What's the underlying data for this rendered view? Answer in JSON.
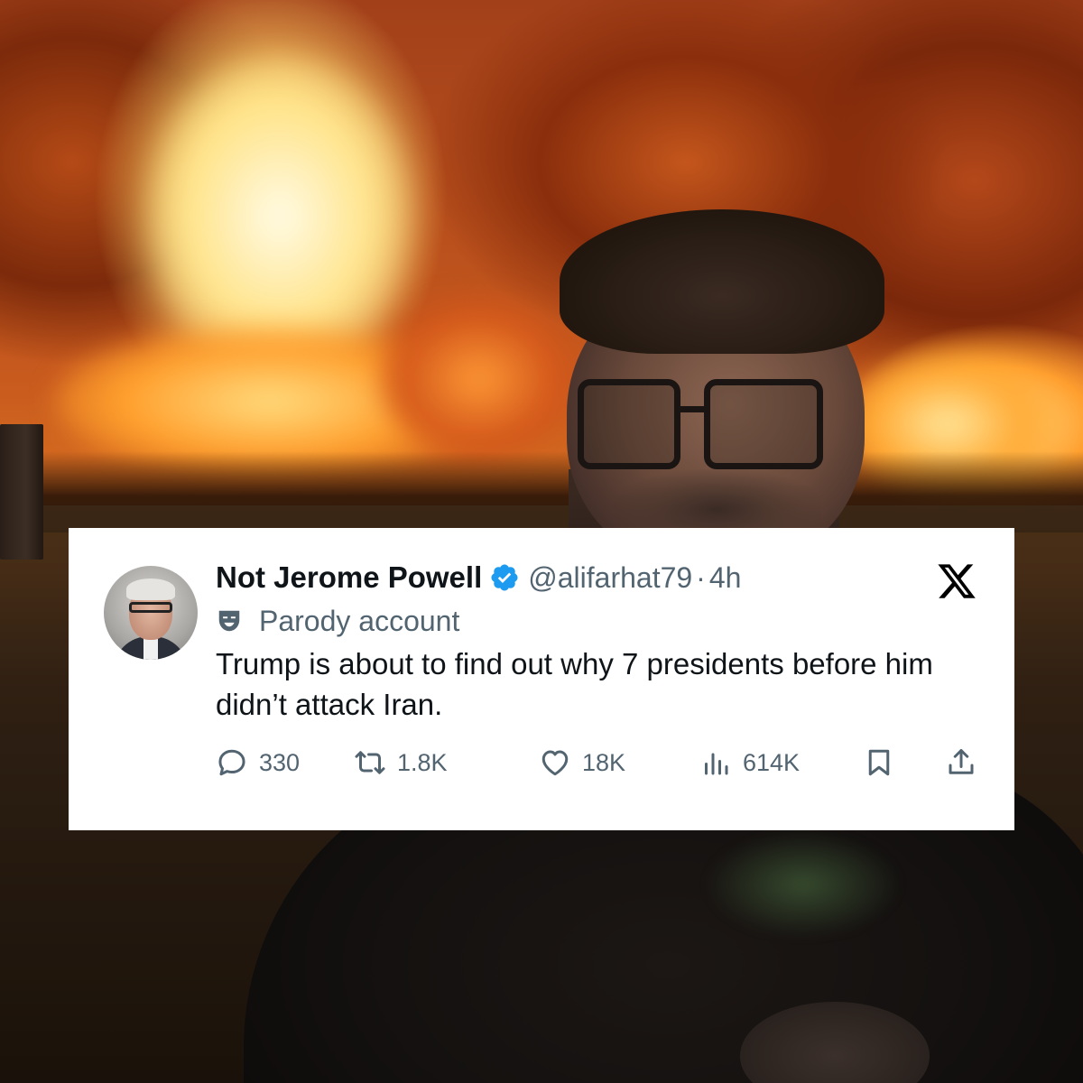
{
  "tweet": {
    "display_name": "Not Jerome Powell",
    "handle": "@alifarhat79",
    "separator": "·",
    "time": "4h",
    "label": "Parody account",
    "text": "Trump is about to find out why 7 presidents before him didn’t attack Iran.",
    "stats": {
      "replies": "330",
      "reposts": "1.8K",
      "likes": "18K",
      "views": "614K"
    }
  },
  "icons": {
    "verified": "verified-badge-icon",
    "x_logo": "x-logo-icon",
    "parody": "parody-mask-icon",
    "reply": "reply-icon",
    "repost": "repost-icon",
    "like": "heart-icon",
    "views": "views-icon",
    "bookmark": "bookmark-icon",
    "share": "share-icon"
  },
  "colors": {
    "verified_blue": "#1d9bf0",
    "text_primary": "#0f1419",
    "text_secondary": "#536471",
    "card_background": "#ffffff"
  }
}
